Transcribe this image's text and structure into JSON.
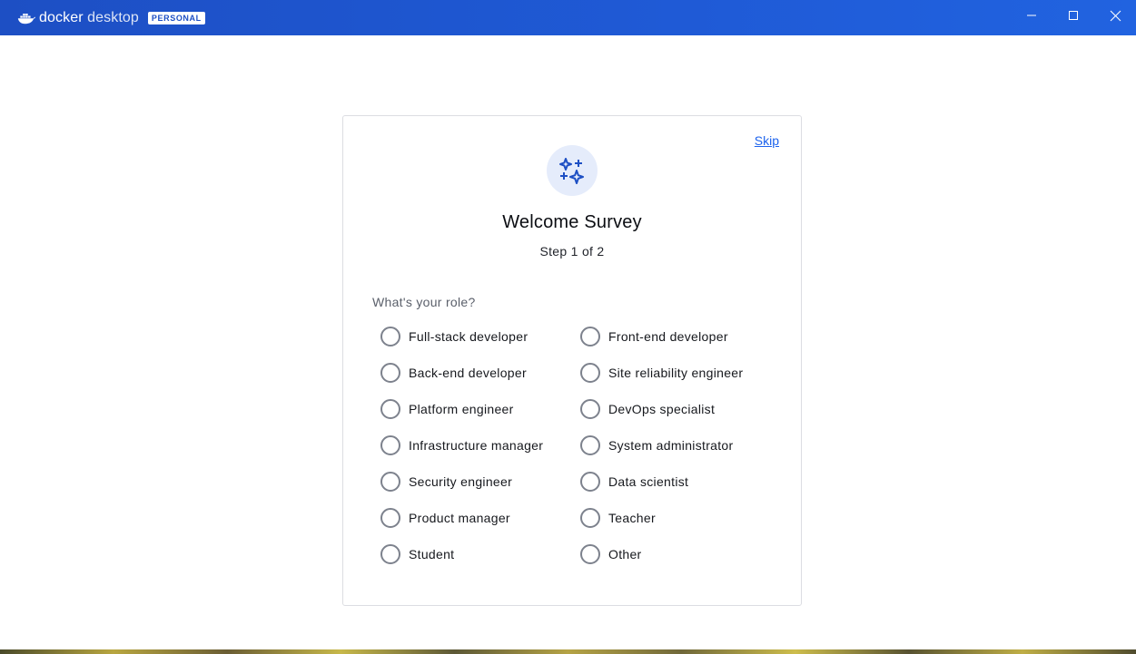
{
  "titlebar": {
    "brand_bold": "docker",
    "brand_light": "desktop",
    "badge": "PERSONAL",
    "controls": [
      "minimize-icon",
      "maximize-icon",
      "close-icon"
    ]
  },
  "survey": {
    "skip_label": "Skip",
    "icon": "sparkles-icon",
    "title": "Welcome Survey",
    "step": "Step 1 of 2",
    "question": "What's your role?",
    "options": [
      "Full-stack developer",
      "Front-end developer",
      "Back-end developer",
      "Site reliability engineer",
      "Platform engineer",
      "DevOps specialist",
      "Infrastructure manager",
      "System administrator",
      "Security engineer",
      "Data scientist",
      "Product manager",
      "Teacher",
      "Student",
      "Other"
    ]
  },
  "colors": {
    "titlebar": "#1d4fc4",
    "accent": "#1d63ed",
    "icon_bg": "#e5ecfb"
  }
}
